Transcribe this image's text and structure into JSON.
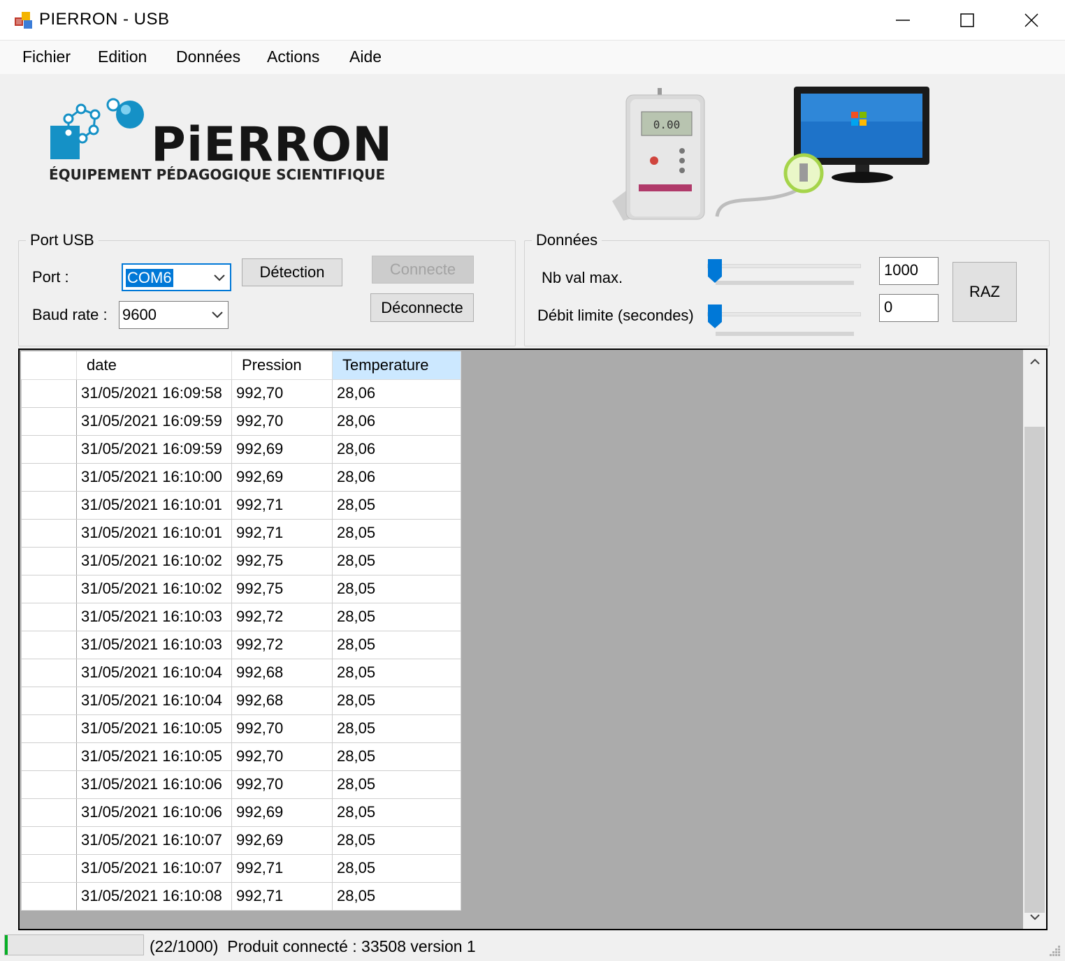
{
  "window": {
    "title": "PIERRON - USB"
  },
  "menu": [
    "Fichier",
    "Edition",
    "Données",
    "Actions",
    "Aide"
  ],
  "logo": {
    "main": "PiERRON",
    "sub": "ÉQUIPEMENT PÉDAGOGIQUE SCIENTIFIQUE"
  },
  "device_display": "0.00",
  "port_usb": {
    "title": "Port USB",
    "port_label": "Port :",
    "port_value": "COM6",
    "baud_label": "Baud rate :",
    "baud_value": "9600",
    "detect_button": "Détection",
    "connect_button": "Connecte",
    "disconnect_button": "Déconnecte"
  },
  "donnees": {
    "title": "Données",
    "nb_label": "Nb val max.",
    "nb_value": "1000",
    "debit_label": "Débit limite (secondes)",
    "debit_value": "0",
    "raz_button": "RAZ"
  },
  "grid": {
    "columns": [
      "date",
      "Pression",
      "Temperature"
    ],
    "active_column": "Temperature",
    "rows": [
      [
        "31/05/2021 16:09:58",
        "992,70",
        "28,06"
      ],
      [
        "31/05/2021 16:09:59",
        "992,70",
        "28,06"
      ],
      [
        "31/05/2021 16:09:59",
        "992,69",
        "28,06"
      ],
      [
        "31/05/2021 16:10:00",
        "992,69",
        "28,06"
      ],
      [
        "31/05/2021 16:10:01",
        "992,71",
        "28,05"
      ],
      [
        "31/05/2021 16:10:01",
        "992,71",
        "28,05"
      ],
      [
        "31/05/2021 16:10:02",
        "992,75",
        "28,05"
      ],
      [
        "31/05/2021 16:10:02",
        "992,75",
        "28,05"
      ],
      [
        "31/05/2021 16:10:03",
        "992,72",
        "28,05"
      ],
      [
        "31/05/2021 16:10:03",
        "992,72",
        "28,05"
      ],
      [
        "31/05/2021 16:10:04",
        "992,68",
        "28,05"
      ],
      [
        "31/05/2021 16:10:04",
        "992,68",
        "28,05"
      ],
      [
        "31/05/2021 16:10:05",
        "992,70",
        "28,05"
      ],
      [
        "31/05/2021 16:10:05",
        "992,70",
        "28,05"
      ],
      [
        "31/05/2021 16:10:06",
        "992,70",
        "28,05"
      ],
      [
        "31/05/2021 16:10:06",
        "992,69",
        "28,05"
      ],
      [
        "31/05/2021 16:10:07",
        "992,69",
        "28,05"
      ],
      [
        "31/05/2021 16:10:07",
        "992,71",
        "28,05"
      ],
      [
        "31/05/2021 16:10:08",
        "992,71",
        "28,05"
      ]
    ]
  },
  "status": {
    "counter": "(22/1000)",
    "message": "Produit connecté : 33508 version 1",
    "progress": 0.022
  },
  "colors": {
    "accent": "#0078d7",
    "logo_blue": "#1591c6",
    "progress_green": "#06b025",
    "grid_background": "#ababab"
  }
}
